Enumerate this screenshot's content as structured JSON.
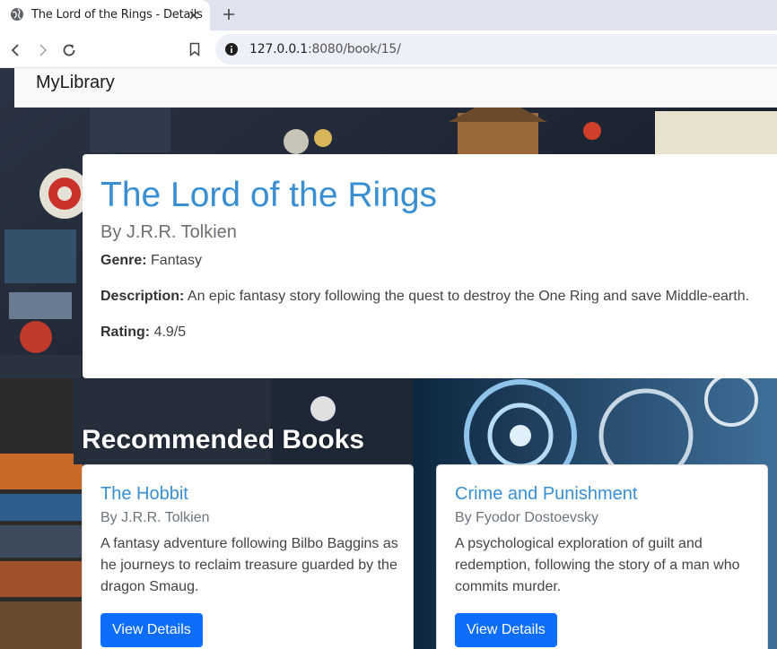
{
  "browser": {
    "tab_title": "The Lord of the Rings - Details",
    "url_host": "127.0.0.1",
    "url_rest": ":8080/book/15/"
  },
  "navbar": {
    "brand": "MyLibrary"
  },
  "book": {
    "title": "The Lord of the Rings",
    "author": "By J.R.R. Tolkien",
    "genre_label": "Genre:",
    "genre": "Fantasy",
    "description_label": "Description:",
    "description": "An epic fantasy story following the quest to destroy the One Ring and save Middle-earth.",
    "rating_label": "Rating:",
    "rating": "4.9/5"
  },
  "recommended": {
    "heading": "Recommended Books",
    "items": [
      {
        "title": "The Hobbit",
        "author": "By J.R.R. Tolkien",
        "description": "A fantasy adventure following Bilbo Baggins as he journeys to reclaim treasure guarded by the dragon Smaug.",
        "button": "View Details"
      },
      {
        "title": "Crime and Punishment",
        "author": "By Fyodor Dostoevsky",
        "description": "A psychological exploration of guilt and redemption, following the story of a man who commits murder.",
        "button": "View Details"
      }
    ]
  },
  "colors": {
    "accent_link": "#3a8fd3",
    "button_primary": "#0d6efd",
    "navbar_bg": "#f8f9fa"
  },
  "icons": [
    "globe-icon",
    "close-icon",
    "plus-icon",
    "back-icon",
    "forward-icon",
    "reload-icon",
    "info-icon",
    "bookmark-icon"
  ]
}
